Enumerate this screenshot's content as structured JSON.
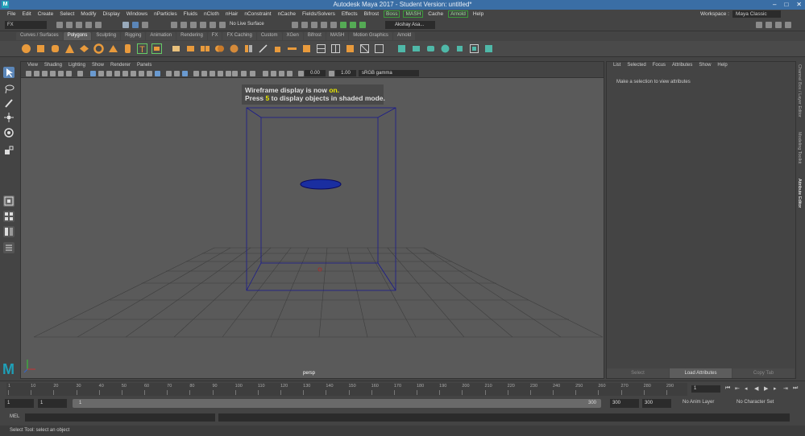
{
  "window": {
    "app_letter": "M",
    "title": "Autodesk Maya 2017 - Student Version: untitled*",
    "controls": [
      "–",
      "□",
      "✕"
    ]
  },
  "menubar": {
    "items": [
      "File",
      "Edit",
      "Create",
      "Select",
      "Modify",
      "Display",
      "Windows",
      "nParticles",
      "Fluids",
      "nCloth",
      "nHair",
      "nConstraint",
      "nCache",
      "Fields/Solvers",
      "Effects",
      "Bifrost"
    ],
    "green_items": [
      "Boss",
      "MASH",
      "Arnold"
    ],
    "help": "Help",
    "workspace_label": "Workspace :",
    "workspace_value": "Maya Classic"
  },
  "statusline": {
    "mode": "FX",
    "live_surface": "No Live Surface",
    "user": "Akshay Asa..."
  },
  "shelf": {
    "tabs": [
      "Curves / Surfaces",
      "Polygons",
      "Sculpting",
      "Rigging",
      "Animation",
      "Rendering",
      "FX",
      "FX Caching",
      "Custom",
      "XGen",
      "Bifrost",
      "MASH",
      "Motion Graphics",
      "Arnold"
    ],
    "active_tab": "Polygons"
  },
  "viewport": {
    "menu": [
      "View",
      "Shading",
      "Lighting",
      "Show",
      "Renderer",
      "Panels"
    ],
    "exposure": "0.00",
    "gamma_value": "1.00",
    "color_space": "sRGB gamma",
    "hud_line1_pre": "Wireframe display is now ",
    "hud_line1_hl": "on.",
    "hud_line2_pre": "Press ",
    "hud_line2_hl": "5",
    "hud_line2_post": " to display objects in shaded mode.",
    "camera": "persp"
  },
  "attribute_editor": {
    "menu": [
      "List",
      "Selected",
      "Focus",
      "Attributes",
      "Show",
      "Help"
    ],
    "message": "Make a selection to view attributes",
    "buttons": [
      "Select",
      "Load Attributes",
      "Copy Tab"
    ],
    "side_tabs": [
      "Channel Box / Layer Editor",
      "Modeling Toolkit",
      "Attribute Editor"
    ]
  },
  "timeline": {
    "ticks": [
      "1",
      "10",
      "20",
      "30",
      "40",
      "50",
      "60",
      "70",
      "80",
      "90",
      "100",
      "110",
      "120",
      "130",
      "140",
      "150",
      "160",
      "170",
      "180",
      "190",
      "200",
      "210",
      "220",
      "230",
      "240",
      "250",
      "260",
      "270",
      "280",
      "290"
    ],
    "current_frame": "1"
  },
  "range": {
    "start": "1",
    "min": "1",
    "bar_start": "1",
    "bar_end": "300",
    "end": "300",
    "max": "300",
    "anim_layer": "No Anim Layer",
    "character_set": "No Character Set"
  },
  "command": {
    "label": "MEL",
    "help": "Select Tool: select an object"
  },
  "colors": {
    "titlebar": "#3a6ea5",
    "wireframe": "#1a1a8c",
    "maya_teal": "#1fa0b8",
    "hud_highlight": "#e6e600"
  }
}
